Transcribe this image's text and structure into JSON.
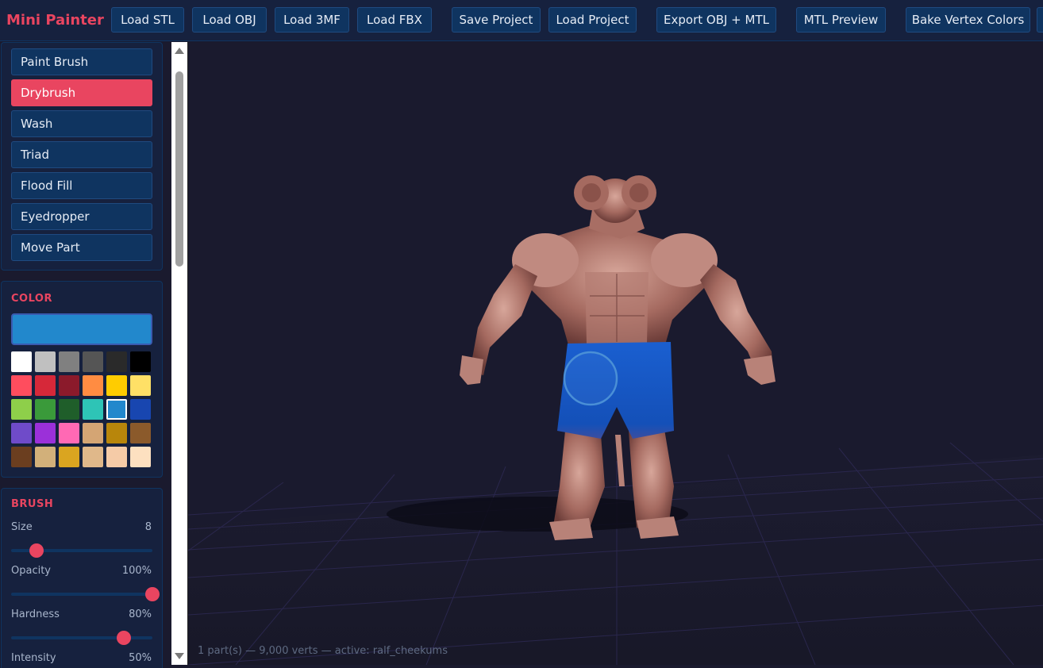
{
  "app": {
    "title": "Mini Painter"
  },
  "toolbar": {
    "buttons": [
      "Load STL",
      "Load OBJ",
      "Load 3MF",
      "Load FBX",
      "Save Project",
      "Load Project",
      "Export OBJ + MTL",
      "MTL Preview",
      "Bake Vertex Colors"
    ]
  },
  "tools": {
    "items": [
      "Paint Brush",
      "Drybrush",
      "Wash",
      "Triad",
      "Flood Fill",
      "Eyedropper",
      "Move Part"
    ],
    "active": "Drybrush"
  },
  "color": {
    "title": "COLOR",
    "current": "#2288cc",
    "palette": [
      "#ffffff",
      "#c0c0c0",
      "#808080",
      "#555555",
      "#2a2a2a",
      "#000000",
      "#ff4d5e",
      "#d62839",
      "#8b1a2b",
      "#ff8c42",
      "#ffcc00",
      "#ffe066",
      "#8ecf4a",
      "#3a9a3a",
      "#1f5e2a",
      "#2ec4b6",
      "#2288cc",
      "#1846b0",
      "#6f4bc9",
      "#9b30d9",
      "#ff69b4",
      "#d4a574",
      "#b8860b",
      "#8b5a2b",
      "#6b3e1f",
      "#d2b07a",
      "#daa520",
      "#e0b88a",
      "#f5cba7",
      "#fde0c0"
    ],
    "selected_index": 16
  },
  "brush": {
    "title": "BRUSH",
    "size": {
      "label": "Size",
      "value": "8",
      "fraction": 0.18
    },
    "opacity": {
      "label": "Opacity",
      "value": "100%",
      "fraction": 1.0
    },
    "hardness": {
      "label": "Hardness",
      "value": "80%",
      "fraction": 0.8
    },
    "intensity": {
      "label": "Intensity",
      "value": "50%"
    }
  },
  "viewport": {
    "status": "1 part(s) — 9,000 verts — active: ralf_cheekums"
  }
}
